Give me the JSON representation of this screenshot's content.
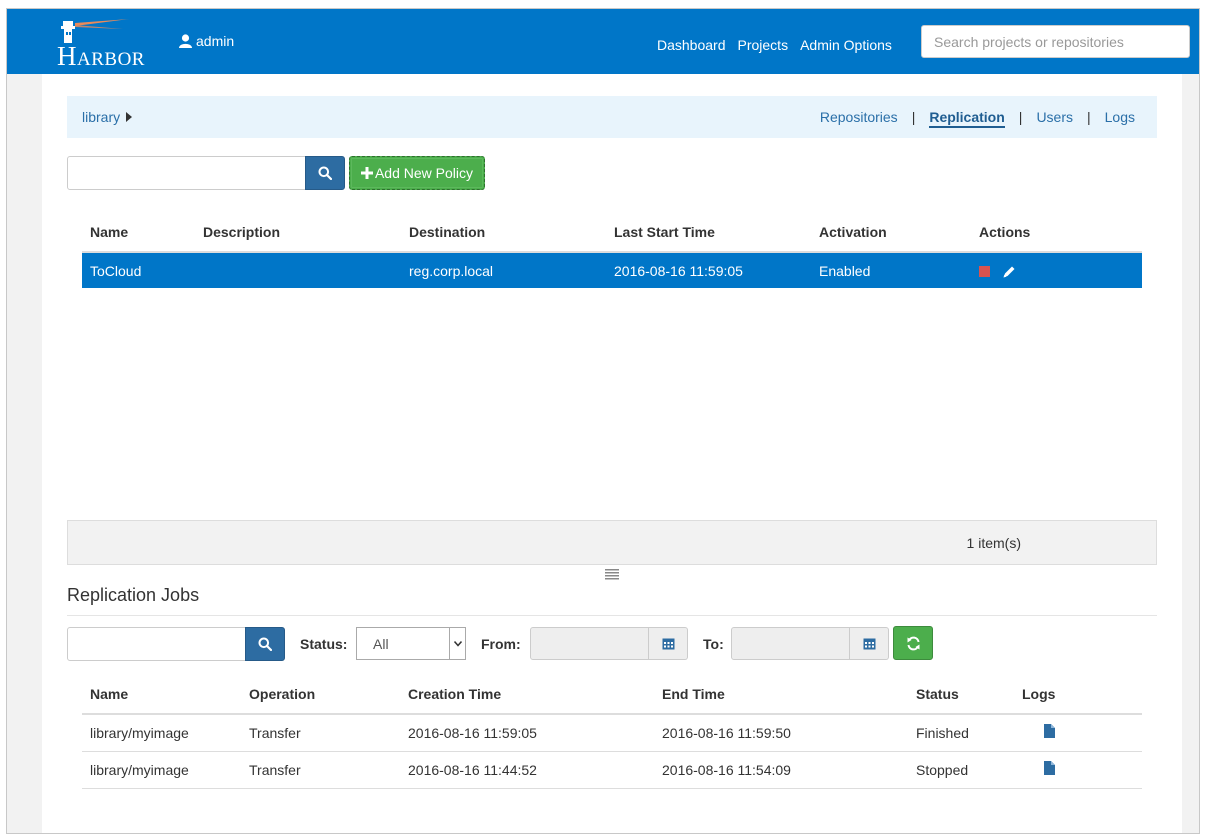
{
  "navbar": {
    "logo_letter": "H",
    "logo_rest": "ARBOR",
    "user": "admin",
    "links": [
      "Dashboard",
      "Projects",
      "Admin Options"
    ],
    "search_placeholder": "Search projects or repositories"
  },
  "subnav": {
    "project": "library",
    "tabs": [
      "Repositories",
      "Replication",
      "Users",
      "Logs"
    ],
    "active_tab": "Replication"
  },
  "policies": {
    "add_button": "Add New Policy",
    "columns": [
      "Name",
      "Description",
      "Destination",
      "Last Start Time",
      "Activation",
      "Actions"
    ],
    "rows": [
      {
        "name": "ToCloud",
        "description": "",
        "destination": "reg.corp.local",
        "last_start": "2016-08-16 11:59:05",
        "activation": "Enabled"
      }
    ],
    "count": "1 item(s)"
  },
  "jobs": {
    "title": "Replication Jobs",
    "status_label": "Status:",
    "status_value": "All",
    "from_label": "From:",
    "to_label": "To:",
    "columns": [
      "Name",
      "Operation",
      "Creation Time",
      "End Time",
      "Status",
      "Logs"
    ],
    "rows": [
      {
        "name": "library/myimage",
        "operation": "Transfer",
        "created": "2016-08-16 11:59:05",
        "ended": "2016-08-16 11:59:50",
        "status": "Finished"
      },
      {
        "name": "library/myimage",
        "operation": "Transfer",
        "created": "2016-08-16 11:44:52",
        "ended": "2016-08-16 11:54:09",
        "status": "Stopped"
      }
    ]
  },
  "colors": {
    "navbar": "#0076c8",
    "primary": "#2d6ca2",
    "success": "#4cae4c",
    "danger": "#d9534f"
  }
}
